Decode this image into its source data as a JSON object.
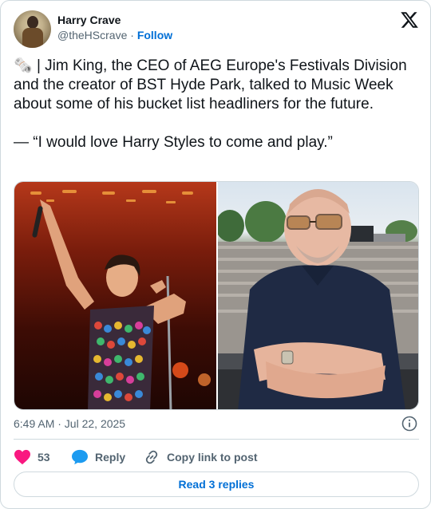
{
  "author": {
    "name": "Harry Crave",
    "handle": "@theHScrave",
    "separator": "·",
    "follow_label": "Follow"
  },
  "icons": {
    "avatar": "avatar-photo",
    "brand": "x-logo-icon",
    "info": "info-icon",
    "like": "heart-icon",
    "reply": "reply-bubble-icon",
    "copy": "link-icon"
  },
  "tweet": {
    "emoji": "🗞️",
    "text": " | Jim King, the CEO of AEG Europe's Festivals Division and the creator of BST Hyde Park, talked to Music Week about some of his bucket list headliners for the future.\n\n— “I would love Harry Styles to come and play.”"
  },
  "meta": {
    "timestamp": "6:49 AM · Jul 22, 2025"
  },
  "actions": {
    "like_count": "53",
    "reply_label": "Reply",
    "copy_label": "Copy link to post"
  },
  "replies_button": "Read 3 replies",
  "colors": {
    "accent": "#006fd6",
    "like": "#f91880",
    "text": "#0f1419",
    "muted": "#536471",
    "border": "#cfd9de"
  }
}
